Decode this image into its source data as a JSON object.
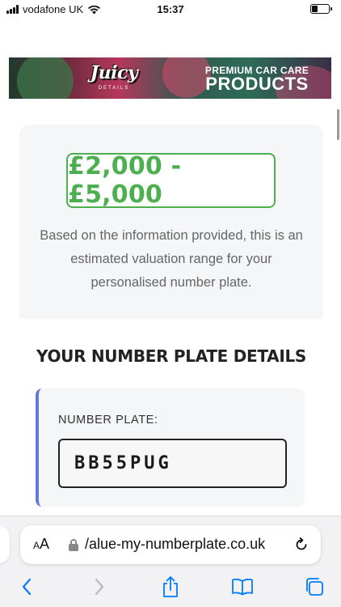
{
  "status_bar": {
    "carrier": "vodafone UK",
    "time": "15:37",
    "battery_level": 0.35,
    "wifi_icon": "wifi-icon",
    "signal_icon": "cellular-signal-icon",
    "battery_icon": "battery-icon"
  },
  "banner": {
    "logo_main": "Juicy",
    "logo_sub": "DETAILS",
    "line1": "PREMIUM CAR CARE",
    "line2": "PRODUCTS"
  },
  "valuation": {
    "price_range": "£2,000 - £5,000",
    "description": "Based on the information provided, this is an estimated valuation range for your personalised number plate."
  },
  "details": {
    "heading": "YOUR NUMBER PLATE DETAILS",
    "plate_label": "NUMBER PLATE:",
    "plate_value": "BB55PUG"
  },
  "browser": {
    "aa_label_small": "A",
    "aa_label_large": "A",
    "url": "/alue-my-numberplate.co.uk",
    "icons": {
      "lock": "lock-icon",
      "reload": "reload-icon",
      "back": "chevron-left-icon",
      "forward": "chevron-right-icon",
      "share": "share-icon",
      "bookmarks": "book-icon",
      "tabs": "tabs-icon"
    }
  },
  "colors": {
    "price_green": "#4caf50",
    "accent_blue": "#007aff",
    "panel_border": "#6a76d8"
  }
}
